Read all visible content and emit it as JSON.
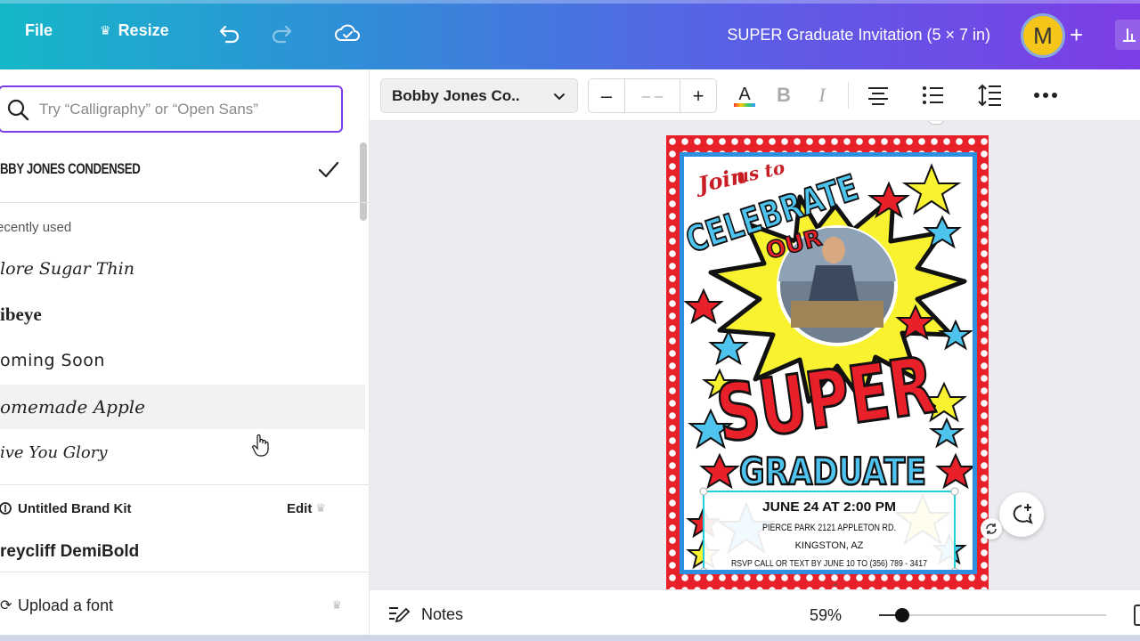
{
  "topbar": {
    "file_label": "File",
    "resize_label": "Resize",
    "undo_icon": "undo-icon",
    "redo_icon": "redo-icon",
    "cloud_icon": "cloud-saved-icon",
    "doc_title": "SUPER Graduate Invitation (5 × 7 in)",
    "avatar_initial": "M",
    "plus_label": "+"
  },
  "font_panel": {
    "search_placeholder": "Try “Calligraphy” or “Open Sans”",
    "selected_font": "BBY JONES CONDENSED",
    "recently_used_label": "ecently used",
    "recent_fonts": [
      "lore Sugar Thin",
      "ibeye",
      "oming Soon",
      "omemade Apple",
      "ive You Glory"
    ],
    "brand_kit_label": "Untitled Brand Kit",
    "brand_edit_label": "Edit",
    "brand_font": "reycliff DemiBold",
    "upload_label": "Upload a font"
  },
  "toolbar": {
    "font_name": "Bobby Jones Co..",
    "size_minus": "–",
    "size_value": "– –",
    "size_plus": "+"
  },
  "canvas": {
    "join_text": "Join",
    "us_to_text": "us to",
    "celebrate_text": "CELEBRATE",
    "our_text": "OUR",
    "super_text": "SUPER",
    "graduate_text": "GRADUATE",
    "date_line": "JUNE 24 AT 2:00 PM",
    "address_line": "PIERCE PARK  2121 APPLETON RD.",
    "city_line": "KINGSTON, AZ",
    "rsvp_line": "RSVP CALL OR TEXT BY JUNE 10 TO (356) 789 - 3417"
  },
  "bottombar": {
    "notes_label": "Notes",
    "zoom_value": "59%",
    "zoom_fraction": 0.1
  },
  "colors": {
    "accent_purple": "#7d3de6",
    "poster_red": "#e8202a",
    "poster_blue": "#2d8fe0",
    "poster_yellow": "#f8f230"
  }
}
